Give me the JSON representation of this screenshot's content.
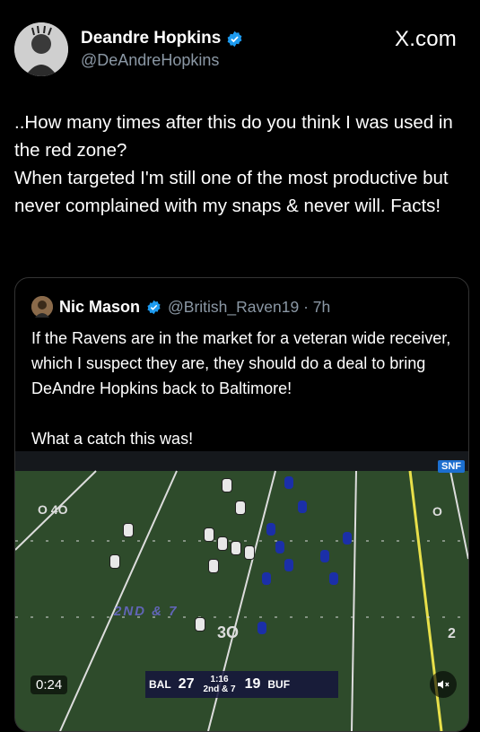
{
  "author": {
    "name": "Deandre Hopkins",
    "handle": "@DeAndreHopkins",
    "avatar_icon": "avatar-photo"
  },
  "site_label": "X.com",
  "tweet_text": "..How many times after this do you think I was used in the red zone?\nWhen targeted I'm still one of the most productive but never complained with my snaps & never will. Facts!",
  "quote": {
    "name": "Nic Mason",
    "handle_time": "@British_Raven19 · 7h",
    "text": "If the Ravens are in the market for a veteran wide receiver, which I suspect they are, they should do a deal to bring DeAndre Hopkins back to Baltimore!\n\nWhat a catch this was!"
  },
  "video": {
    "time": "0:24",
    "network": "SNF",
    "down_distance": "2ND & 7",
    "away_team": "BAL",
    "away_score": "27",
    "home_score": "19",
    "home_team": "BUF",
    "clock": "1:16",
    "down_label": "2nd & 7"
  },
  "colors": {
    "verified": "#1d9bf0",
    "muted_text": "#8b98a5",
    "field": "#2f4a2a"
  }
}
